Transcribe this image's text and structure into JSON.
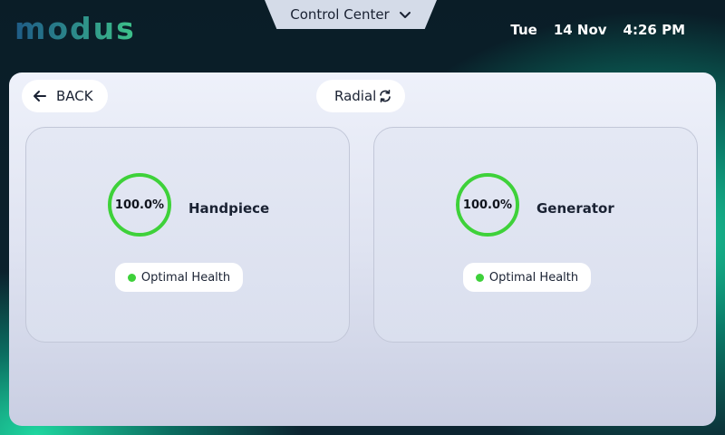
{
  "brand": {
    "logo_text": "modus"
  },
  "header": {
    "menu_label": "Control Center",
    "day": "Tue",
    "date": "14 Nov",
    "time": "4:26 PM"
  },
  "toolbar": {
    "back_label": "BACK",
    "view_label": "Radial",
    "icons": {
      "back": "arrow-left-icon",
      "view": "refresh-swap-icon",
      "menu": "chevron-down-icon"
    }
  },
  "colors": {
    "healthy": "#3ed13a",
    "panel": "#e6e9f4"
  },
  "devices": [
    {
      "name": "Handpiece",
      "health_percent": 100.0,
      "health_display": "100.0%",
      "status": "Optimal Health"
    },
    {
      "name": "Generator",
      "health_percent": 100.0,
      "health_display": "100.0%",
      "status": "Optimal Health"
    }
  ]
}
